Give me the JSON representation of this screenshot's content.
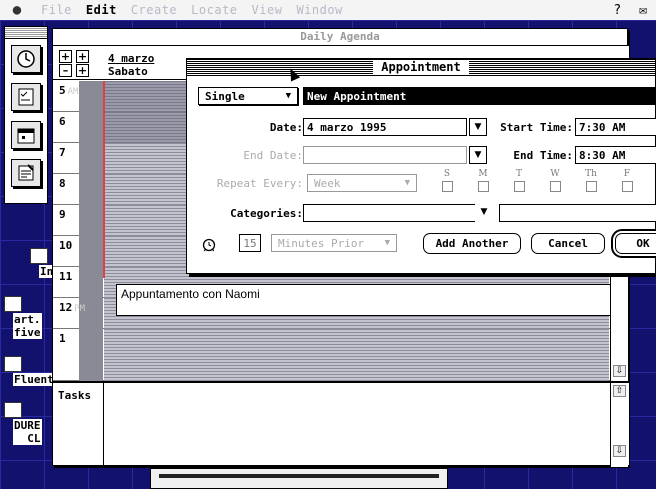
{
  "menubar": {
    "menus": [
      "File",
      "Edit",
      "Create",
      "Locate",
      "View",
      "Window"
    ],
    "help_glyph": "?",
    "app_glyph": "✉"
  },
  "desktop_icons": [
    {
      "label": "Inte"
    },
    {
      "label": "art. five"
    },
    {
      "label": "Fluent"
    },
    {
      "label": "DURE CL"
    }
  ],
  "agenda": {
    "title": "Daily Agenda",
    "date_line1": "4 marzo",
    "date_line2": "Sabato",
    "hours": [
      {
        "label": "5",
        "ampm": "AM"
      },
      {
        "label": "6",
        "ampm": ""
      },
      {
        "label": "7",
        "ampm": ""
      },
      {
        "label": "8",
        "ampm": ""
      },
      {
        "label": "9",
        "ampm": ""
      },
      {
        "label": "10",
        "ampm": ""
      },
      {
        "label": "11",
        "ampm": ""
      },
      {
        "label": "12",
        "ampm": "PM"
      },
      {
        "label": "1",
        "ampm": ""
      }
    ],
    "event_text": "Appuntamento con Naomi",
    "tasks_label": "Tasks"
  },
  "appointment": {
    "title": "Appointment",
    "type_popup": "Single",
    "name_value": "New Appointment",
    "date_label": "Date:",
    "date_value": "4 marzo 1995",
    "start_time_label": "Start Time:",
    "start_time_value": "7:30 AM",
    "end_date_label": "End Date:",
    "end_date_value": "",
    "end_time_label": "End Time:",
    "end_time_value": "8:30 AM",
    "repeat_label": "Repeat Every:",
    "repeat_value": "Week",
    "days": [
      "S",
      "M",
      "T",
      "W",
      "Th",
      "F"
    ],
    "categories_label": "Categories:",
    "categories_value": "",
    "alarm_minutes": "15",
    "alarm_unit": "Minutes Prior",
    "add_another_label": "Add Another",
    "cancel_label": "Cancel",
    "ok_label": "OK"
  },
  "colors": {
    "desktop": "#12126e",
    "timeline_red": "#e04040",
    "slot_gray": "#c4c4ce"
  }
}
